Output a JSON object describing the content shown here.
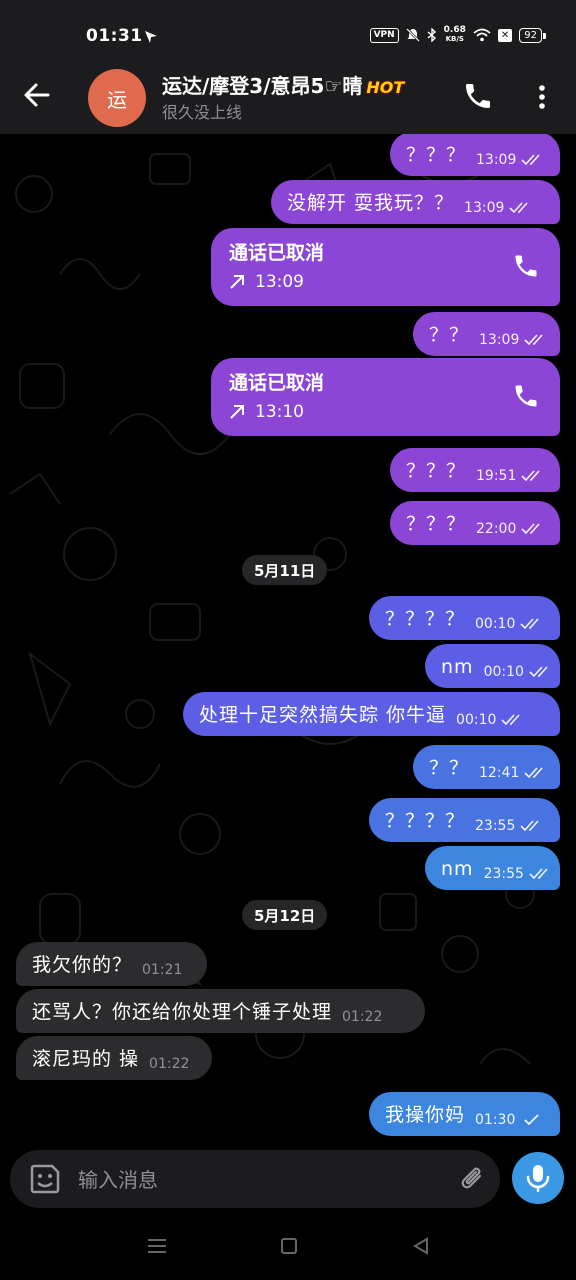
{
  "status_bar": {
    "time": "01:31",
    "vpn_label": "VPN",
    "net_speed_value": "0.68",
    "net_speed_unit": "KB/S",
    "x_badge": "✕",
    "battery": "92"
  },
  "header": {
    "avatar_letter": "运",
    "title": "运达/摩登3/意昂5☞晴",
    "hot_badge": "HOT",
    "subtitle": "很久没上线"
  },
  "colors": {
    "purple_bubble": "#8b46d6",
    "indigo_bubble": "#5c5ee6",
    "blue_bubble": "#3d86e0",
    "incoming_bubble": "#2c2c2e",
    "mic_button": "#3a98e5"
  },
  "messages": {
    "m1": {
      "text": "？？？",
      "time": "13:09"
    },
    "m2": {
      "text": "没解开 耍我玩？？",
      "time": "13:09"
    },
    "c1": {
      "title": "通话已取消",
      "time": "13:09"
    },
    "m3": {
      "text": "？？",
      "time": "13:09"
    },
    "c2": {
      "title": "通话已取消",
      "time": "13:10"
    },
    "m4": {
      "text": "？？？",
      "time": "19:51"
    },
    "m5": {
      "text": "？？？",
      "time": "22:00"
    },
    "d1": "5月11日",
    "m6": {
      "text": "？？？？",
      "time": "00:10"
    },
    "m7": {
      "text": "nm",
      "time": "00:10"
    },
    "m8": {
      "text": "处理十足突然搞失踪 你牛逼",
      "time": "00:10"
    },
    "m9": {
      "text": "？？",
      "time": "12:41"
    },
    "m10": {
      "text": "？？？？",
      "time": "23:55"
    },
    "m11": {
      "text": "nm",
      "time": "23:55"
    },
    "d2": "5月12日",
    "i1": {
      "text": "我欠你的？",
      "time": "01:21"
    },
    "i2": {
      "text": "还骂人？你还给你处理个锤子处理",
      "time": "01:22"
    },
    "i3": {
      "text": "滚尼玛的 操",
      "time": "01:22"
    },
    "m12": {
      "text": "我操你妈",
      "time": "01:30"
    }
  },
  "composer": {
    "placeholder": "输入消息"
  },
  "icons": {
    "back": "arrow-left-icon",
    "call": "phone-icon",
    "more": "more-vertical-icon",
    "read_receipt": "double-check-icon",
    "sent_receipt": "check-icon",
    "outgoing_call": "arrow-up-right-icon",
    "sticker": "sticker-icon",
    "attach": "paperclip-icon",
    "mic": "mic-icon"
  }
}
